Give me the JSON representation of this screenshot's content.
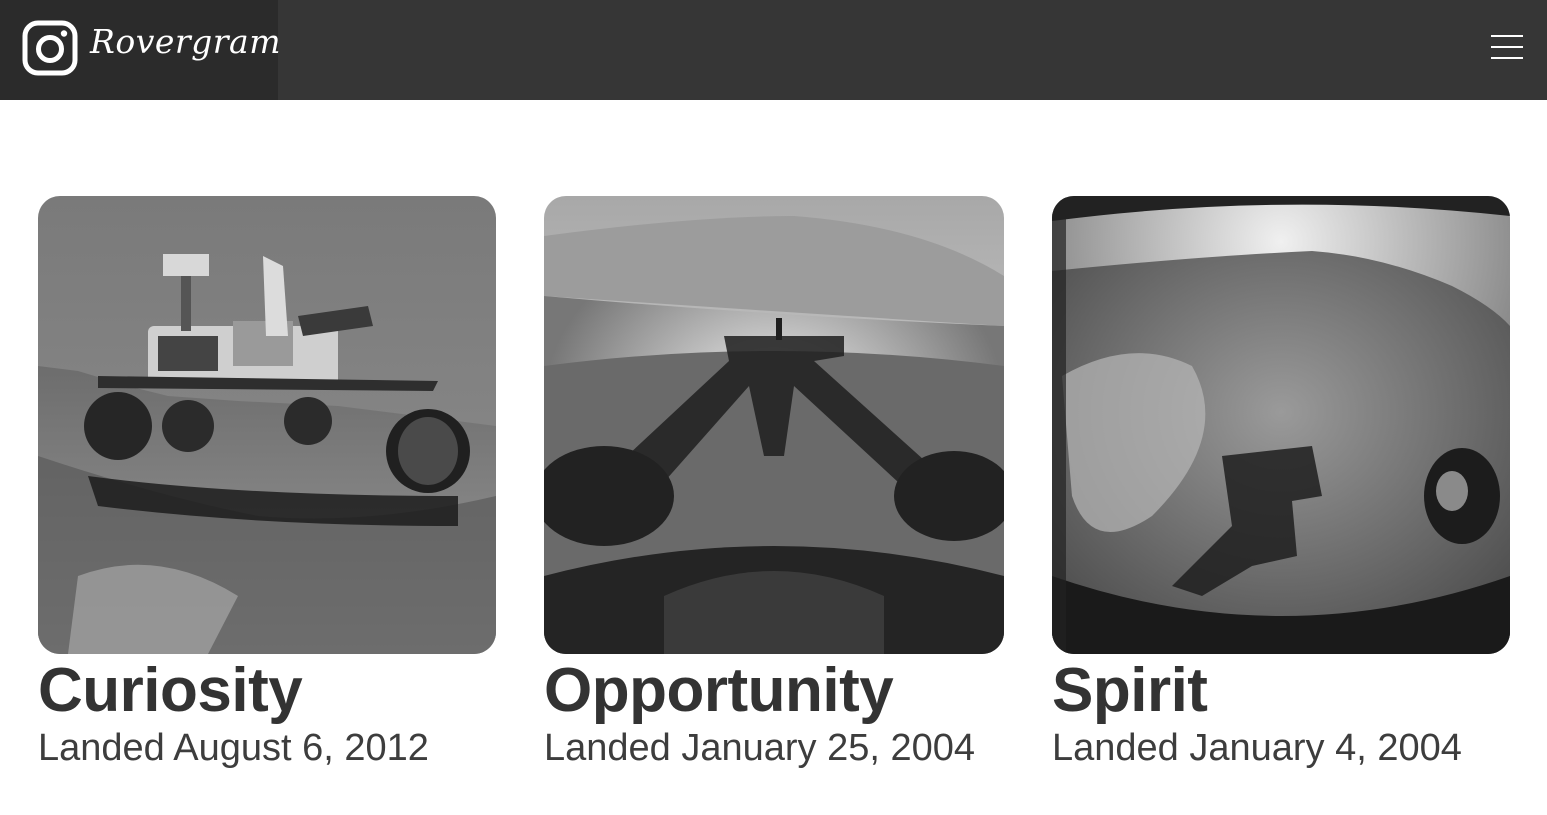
{
  "app": {
    "name": "Rovergram",
    "logo_icon": "camera-icon",
    "menu_icon": "hamburger-icon"
  },
  "rovers": [
    {
      "name": "Curiosity",
      "landed": "Landed August 6, 2012"
    },
    {
      "name": "Opportunity",
      "landed": "Landed January 25, 2004"
    },
    {
      "name": "Spirit",
      "landed": "Landed January 4, 2004"
    }
  ],
  "colors": {
    "navbar": "#363636",
    "brand_bg": "#2b2b2b",
    "title_text": "#333333"
  }
}
